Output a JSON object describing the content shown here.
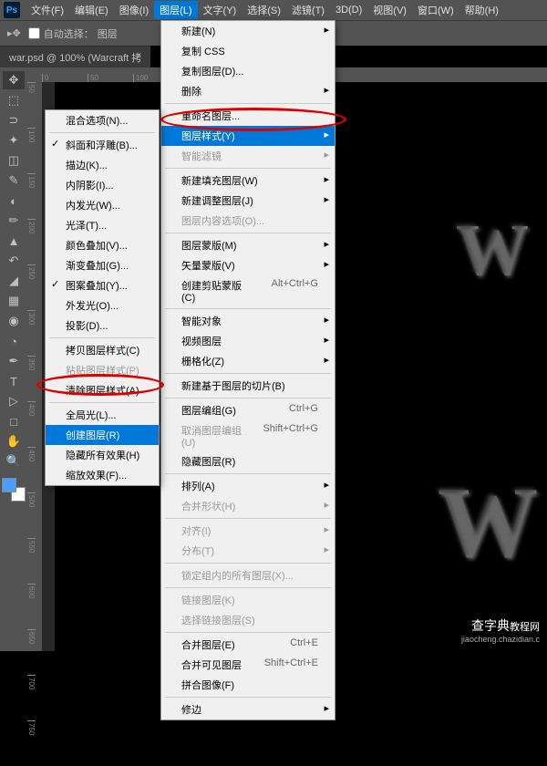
{
  "menubar": {
    "items": [
      "文件(F)",
      "编辑(E)",
      "图像(I)",
      "图层(L)",
      "文字(Y)",
      "选择(S)",
      "滤镜(T)",
      "3D(D)",
      "视图(V)",
      "窗口(W)",
      "帮助(H)"
    ]
  },
  "options": {
    "auto_select": "自动选择：",
    "layer_label": "图层"
  },
  "doc_tab": "war.psd @ 100% (Warcraft 拷",
  "ruler_h": [
    "0",
    "50",
    "100"
  ],
  "ruler_v": [
    "50",
    "100",
    "150",
    "200",
    "250",
    "300",
    "350",
    "400",
    "450",
    "500",
    "550",
    "600",
    "650",
    "700",
    "750"
  ],
  "artwork1": "W",
  "artwork2": "W",
  "submenu1": {
    "items": [
      {
        "label": "混合选项(N)...",
        "check": false
      },
      {
        "sep": true
      },
      {
        "label": "斜面和浮雕(B)...",
        "check": true
      },
      {
        "label": "描边(K)...",
        "check": false
      },
      {
        "label": "内阴影(I)...",
        "check": false
      },
      {
        "label": "内发光(W)...",
        "check": false
      },
      {
        "label": "光泽(T)...",
        "check": false
      },
      {
        "label": "颜色叠加(V)...",
        "check": false
      },
      {
        "label": "渐变叠加(G)...",
        "check": false
      },
      {
        "label": "图案叠加(Y)...",
        "check": true
      },
      {
        "label": "外发光(O)...",
        "check": false
      },
      {
        "label": "投影(D)...",
        "check": false
      },
      {
        "sep": true
      },
      {
        "label": "拷贝图层样式(C)",
        "check": false
      },
      {
        "label": "粘贴图层样式(P)",
        "check": false,
        "disabled": true
      },
      {
        "label": "清除图层样式(A)",
        "check": false
      },
      {
        "sep": true
      },
      {
        "label": "全局光(L)...",
        "check": false
      },
      {
        "label": "创建图层(R)",
        "check": false,
        "highlight": true
      },
      {
        "label": "隐藏所有效果(H)",
        "check": false
      },
      {
        "label": "缩放效果(F)...",
        "check": false
      }
    ]
  },
  "mainmenu": {
    "items": [
      {
        "label": "新建(N)",
        "arrow": true
      },
      {
        "label": "复制 CSS"
      },
      {
        "label": "复制图层(D)..."
      },
      {
        "label": "删除",
        "arrow": true
      },
      {
        "sep": true
      },
      {
        "label": "重命名图层..."
      },
      {
        "label": "图层样式(Y)",
        "arrow": true,
        "highlight": true
      },
      {
        "label": "智能滤镜",
        "arrow": true,
        "disabled": true
      },
      {
        "sep": true
      },
      {
        "label": "新建填充图层(W)",
        "arrow": true
      },
      {
        "label": "新建调整图层(J)",
        "arrow": true
      },
      {
        "label": "图层内容选项(O)...",
        "disabled": true
      },
      {
        "sep": true
      },
      {
        "label": "图层蒙版(M)",
        "arrow": true
      },
      {
        "label": "矢量蒙版(V)",
        "arrow": true
      },
      {
        "label": "创建剪贴蒙版(C)",
        "shortcut": "Alt+Ctrl+G"
      },
      {
        "sep": true
      },
      {
        "label": "智能对象",
        "arrow": true
      },
      {
        "label": "视频图层",
        "arrow": true
      },
      {
        "label": "栅格化(Z)",
        "arrow": true
      },
      {
        "sep": true
      },
      {
        "label": "新建基于图层的切片(B)"
      },
      {
        "sep": true
      },
      {
        "label": "图层编组(G)",
        "shortcut": "Ctrl+G"
      },
      {
        "label": "取消图层编组(U)",
        "shortcut": "Shift+Ctrl+G",
        "disabled": true
      },
      {
        "label": "隐藏图层(R)"
      },
      {
        "sep": true
      },
      {
        "label": "排列(A)",
        "arrow": true
      },
      {
        "label": "合并形状(H)",
        "arrow": true,
        "disabled": true
      },
      {
        "sep": true
      },
      {
        "label": "对齐(I)",
        "arrow": true,
        "disabled": true
      },
      {
        "label": "分布(T)",
        "arrow": true,
        "disabled": true
      },
      {
        "sep": true
      },
      {
        "label": "锁定组内的所有图层(X)...",
        "disabled": true
      },
      {
        "sep": true
      },
      {
        "label": "链接图层(K)",
        "disabled": true
      },
      {
        "label": "选择链接图层(S)",
        "disabled": true
      },
      {
        "sep": true
      },
      {
        "label": "合并图层(E)",
        "shortcut": "Ctrl+E"
      },
      {
        "label": "合并可见图层",
        "shortcut": "Shift+Ctrl+E"
      },
      {
        "label": "拼合图像(F)"
      },
      {
        "sep": true
      },
      {
        "label": "修边",
        "arrow": true
      }
    ]
  },
  "watermark": {
    "main": "查字典",
    "sub": "教程网",
    "url": "jiaocheng.chazidian.c"
  }
}
